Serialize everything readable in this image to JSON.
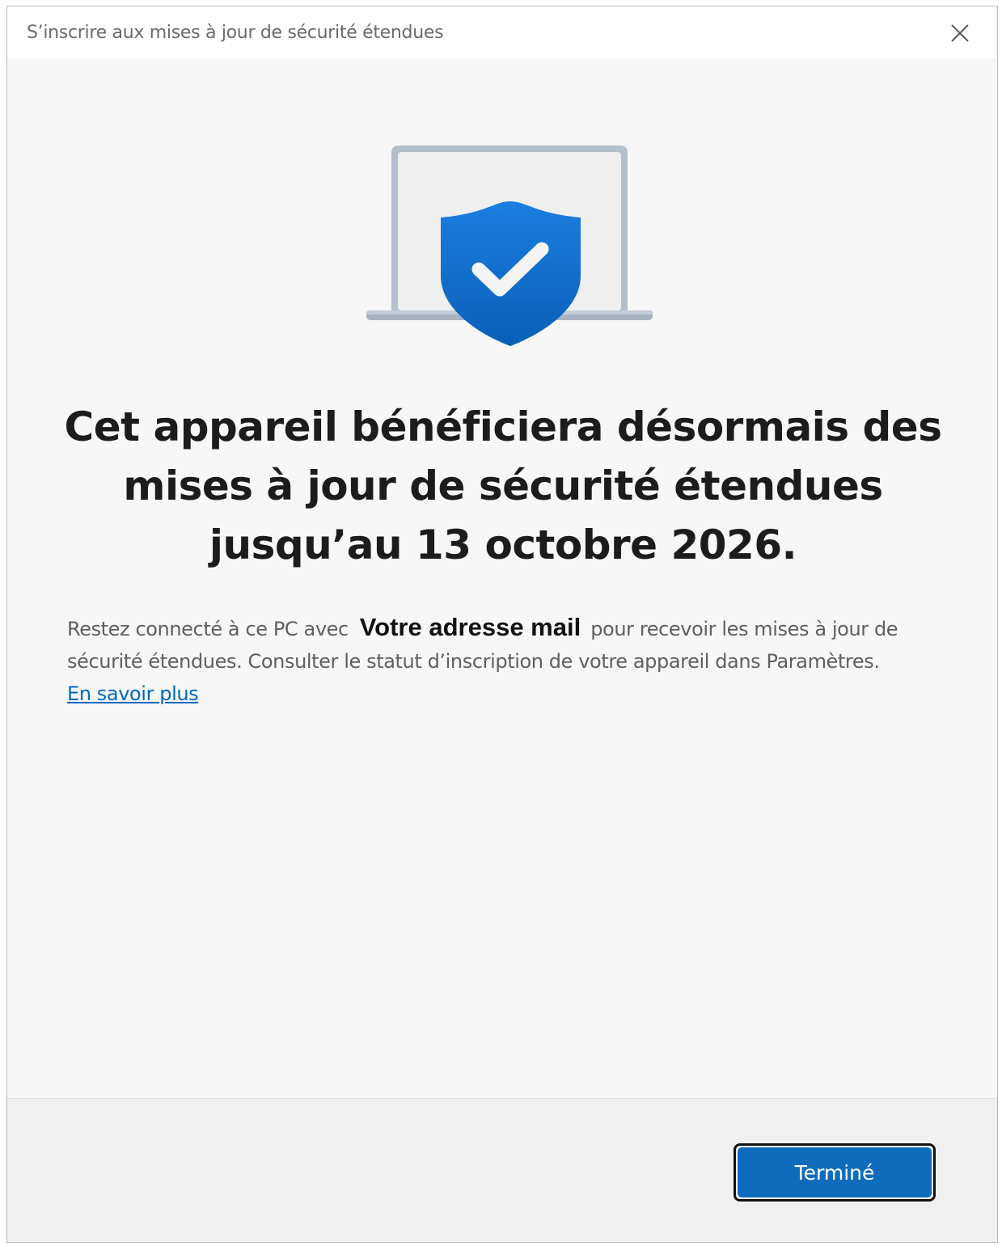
{
  "window": {
    "title": "S’inscrire aux mises à jour de sécurité étendues"
  },
  "illustration": {
    "icon": "laptop-shield-check-icon",
    "accent_color": "#0f6cbd"
  },
  "main": {
    "heading": "Cet appareil bénéficiera désormais des mises à jour de sécurité étendues jusqu’au 13 octobre 2026.",
    "body_before_email": "Restez connecté à ce PC avec",
    "email": "Votre adresse mail",
    "body_after_email": "pour recevoir les mises à jour de sécurité étendues. Consulter le statut d’inscription de votre appareil dans Paramètres.",
    "learn_more_link": "En savoir plus"
  },
  "footer": {
    "done_button_label": "Terminé"
  }
}
